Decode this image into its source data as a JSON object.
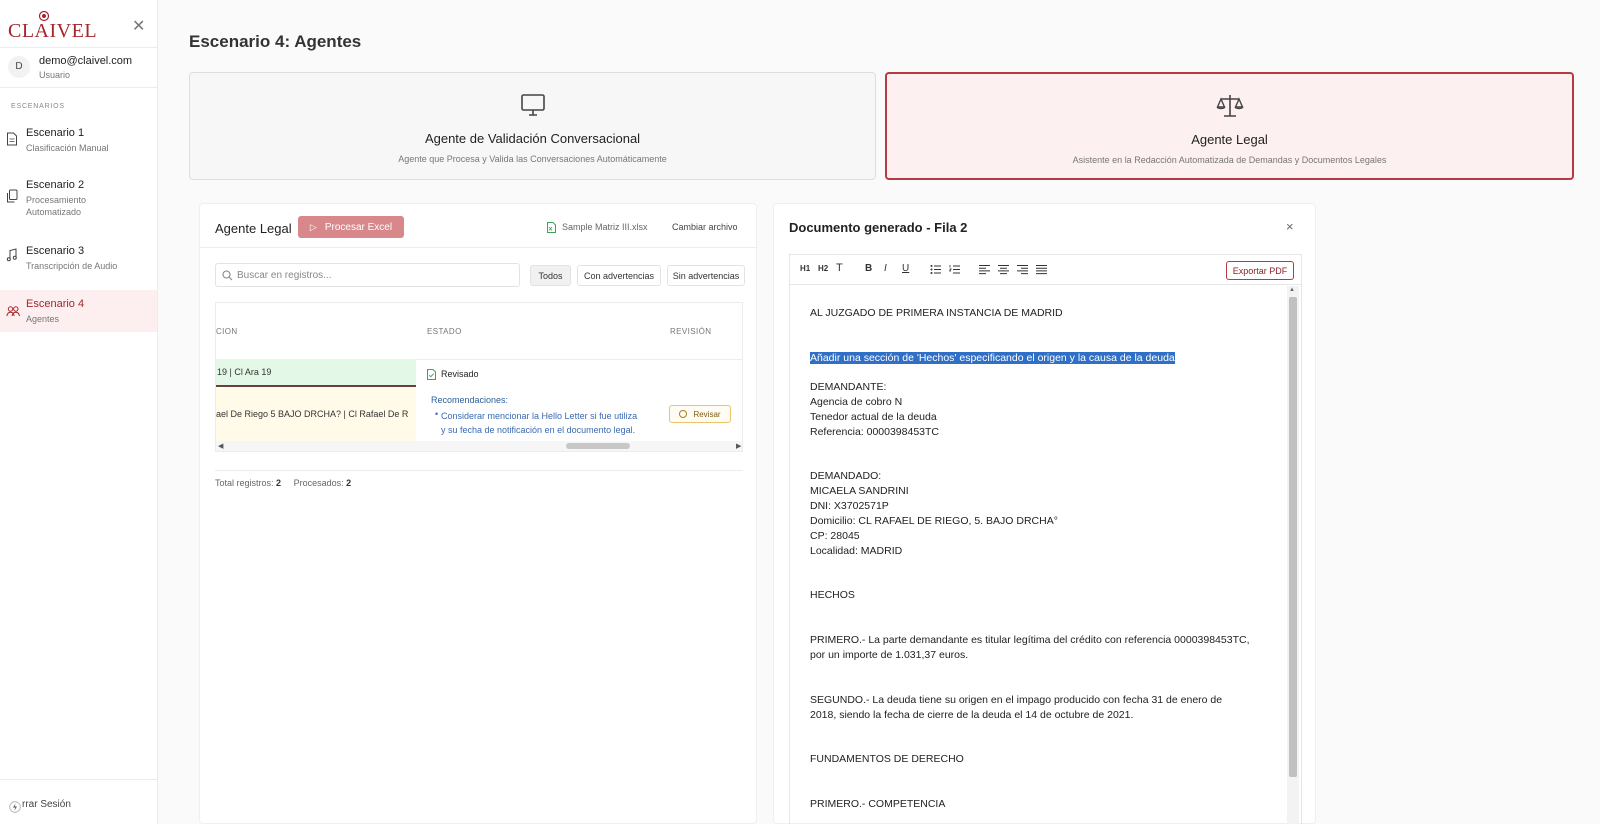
{
  "app": {
    "logo": "CLAIVEL",
    "user_initial": "D",
    "user_email": "demo@claivel.com",
    "user_role": "Usuario",
    "section_label": "ESCENARIOS",
    "nav": [
      {
        "title": "Escenario 1",
        "sub": "Clasificación Manual",
        "icon": "document-icon"
      },
      {
        "title": "Escenario 2",
        "sub": "Procesamiento Automatizado",
        "icon": "copy-icon"
      },
      {
        "title": "Escenario 3",
        "sub": "Transcripción de Audio",
        "icon": "music-note-icon"
      },
      {
        "title": "Escenario 4",
        "sub": "Agentes",
        "icon": "people-icon"
      }
    ],
    "logout_label": "rrar Sesión"
  },
  "page": {
    "title": "Escenario 4: Agentes"
  },
  "agents": [
    {
      "title": "Agente de Validación Conversacional",
      "desc": "Agente que Procesa y Valida las Conversaciones Automáticamente",
      "icon": "monitor-icon",
      "selected": false
    },
    {
      "title": "Agente Legal",
      "desc": "Asistente en la Redacción Automatizada de Demandas y Documentos Legales",
      "icon": "scales-icon",
      "selected": true
    }
  ],
  "left_panel": {
    "title": "Agente Legal",
    "process_label": "Procesar Excel",
    "file_name": "Sample Matriz III.xlsx",
    "change_file": "Cambiar archivo",
    "search_placeholder": "Buscar en registros...",
    "filters": [
      "Todos",
      "Con advertencias",
      "Sin advertencias"
    ],
    "columns": [
      "CION",
      "ESTADO",
      "REVISIÓN"
    ],
    "rows": [
      {
        "address": "19 | Cl Ara 19",
        "status": "Revisado"
      },
      {
        "address": "ael De Riego 5 BAJO DRCHA? | Cl Rafael De R",
        "rec_title": "Recomendaciones:",
        "rec_lines": [
          "Considerar mencionar la Hello Letter si fue utiliza",
          "y su fecha de notificación en el documento legal."
        ],
        "review_label": "Revisar"
      }
    ],
    "totals_label": "Total registros:",
    "totals_value": "2",
    "processed_label": "Procesados:",
    "processed_value": "2"
  },
  "right_panel": {
    "title": "Documento generado - Fila 2",
    "close": "×",
    "toolbar": [
      "H1",
      "H2",
      "T",
      "B",
      "I",
      "U"
    ],
    "export_label": "Exportar PDF",
    "doc": {
      "p1": "AL JUZGADO DE PRIMERA INSTANCIA DE MADRID",
      "highlight": "Añadir una sección de 'Hechos' especificando el origen y la causa de la deuda",
      "p2": "DEMANDANTE:\nAgencia de cobro N\nTenedor actual de la deuda\nReferencia: 0000398453TC",
      "p3": "DEMANDADO:\nMICAELA SANDRINI\nDNI: X3702571P\nDomicilio: CL RAFAEL DE RIEGO, 5. BAJO DRCHA°\nCP: 28045\nLocalidad: MADRID",
      "p4": "HECHOS",
      "p5": "PRIMERO.- La parte demandante es titular legítima del crédito con referencia 0000398453TC, por un importe de 1.031,37 euros.",
      "p6": "SEGUNDO.- La deuda tiene su origen en el impago producido con fecha 31 de enero de 2018, siendo la fecha de cierre de la deuda el 14 de octubre de 2021.",
      "p7": "FUNDAMENTOS DE DERECHO",
      "p8": "PRIMERO.- COMPETENCIA"
    }
  },
  "colors": {
    "brand": "#a4262c",
    "active_bg": "#fdeff0",
    "highlight": "#2f6fc6"
  }
}
